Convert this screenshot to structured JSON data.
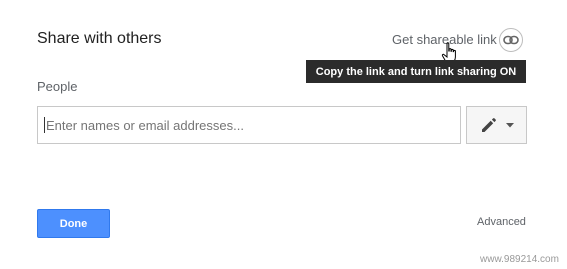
{
  "dialog": {
    "title": "Share with others",
    "share_link_label": "Get shareable link",
    "tooltip": "Copy the link and turn link sharing ON",
    "people_label": "People",
    "input_placeholder": "Enter names or email addresses...",
    "done_label": "Done",
    "advanced_label": "Advanced"
  },
  "icons": {
    "link": "link-icon",
    "edit": "pencil-icon",
    "dropdown": "caret-down-icon",
    "cursor": "hand-pointer-icon"
  },
  "colors": {
    "accent": "#4d90fe",
    "tooltip_bg": "#2b2b2b",
    "label": "#5f6368"
  },
  "watermark": "www.989214.com"
}
